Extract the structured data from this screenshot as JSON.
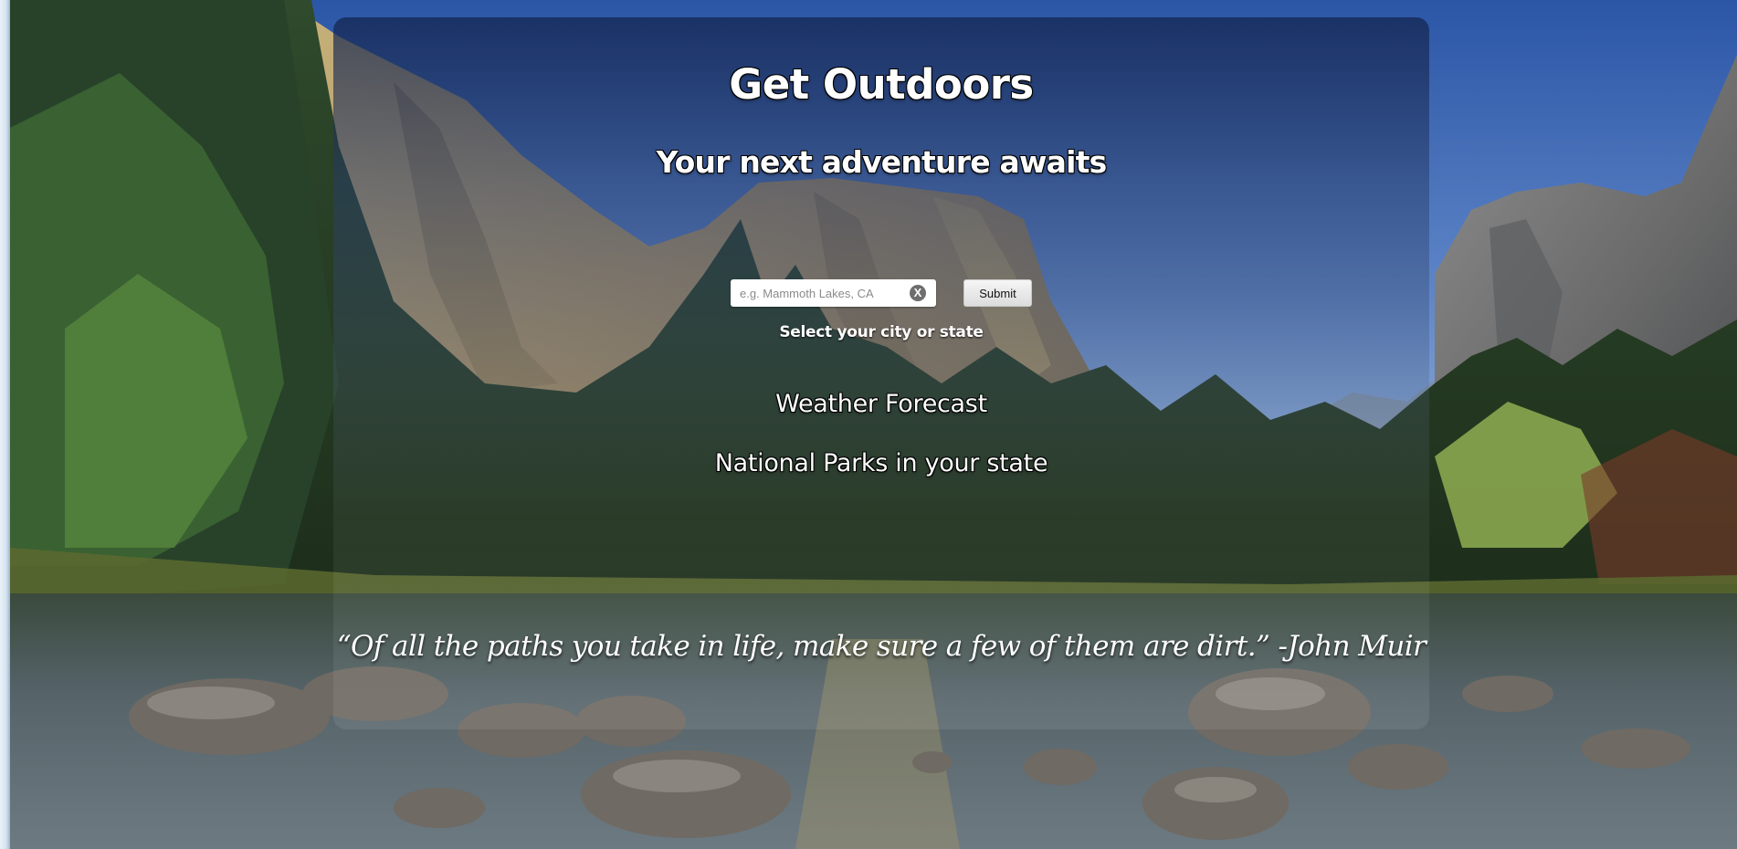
{
  "header": {
    "title": "Get Outdoors",
    "tagline": "Your next adventure awaits"
  },
  "search": {
    "placeholder": "e.g. Mammoth Lakes, CA",
    "value": "",
    "clear_icon": "clear-icon",
    "clear_glyph": "X",
    "submit_label": "Submit",
    "helper_text": "Select your city or state"
  },
  "sections": {
    "weather_heading": "Weather Forecast",
    "parks_heading": "National Parks in your state"
  },
  "footer": {
    "quote": "“Of all the paths you take in life, make sure a few of them are dirt.” -John Muir"
  },
  "colors": {
    "panel_overlay": "#1c2f5e",
    "sky": "#2d58a8",
    "text": "#ffffff",
    "button": "#e6e6e6"
  }
}
